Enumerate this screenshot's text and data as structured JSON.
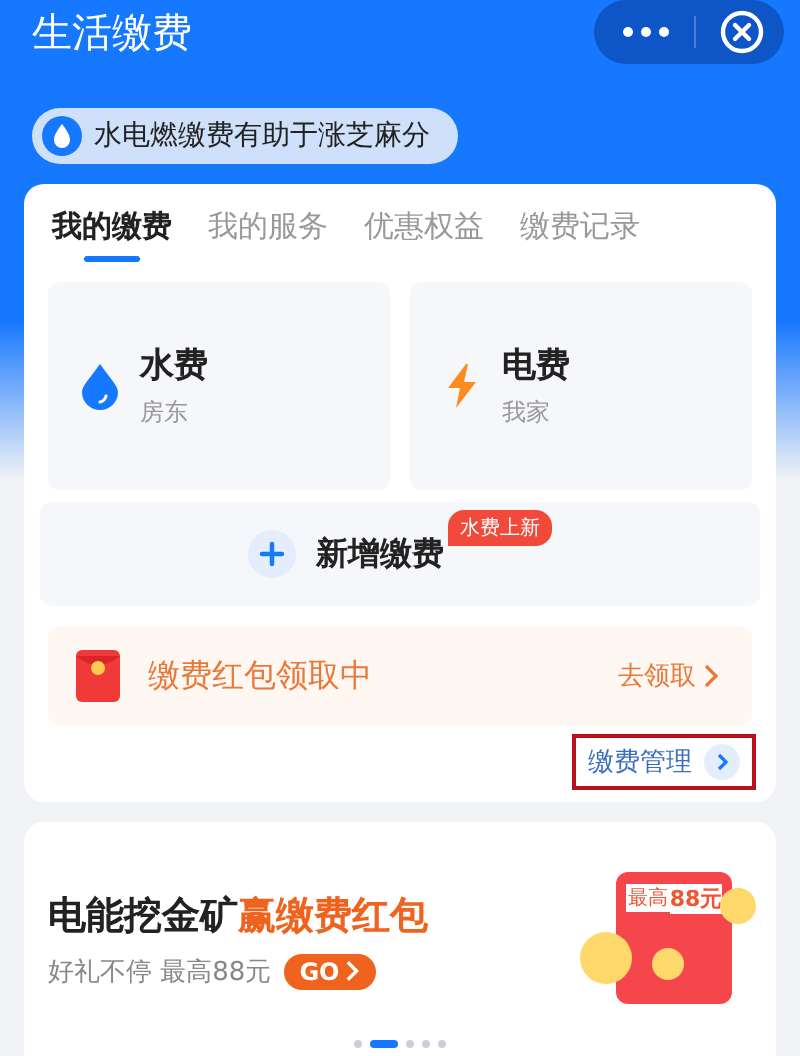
{
  "header": {
    "title": "生活缴费"
  },
  "promo_pill": {
    "text": "水电燃缴费有助于涨芝麻分"
  },
  "tabs": [
    {
      "label": "我的缴费",
      "selected": true
    },
    {
      "label": "我的服务",
      "selected": false
    },
    {
      "label": "优惠权益",
      "selected": false
    },
    {
      "label": "缴费记录",
      "selected": false
    }
  ],
  "bills": [
    {
      "kind": "water",
      "name": "水费",
      "account": "房东"
    },
    {
      "kind": "electric",
      "name": "电费",
      "account": "我家"
    }
  ],
  "add_bill": {
    "label": "新增缴费",
    "badge": "水费上新"
  },
  "red_packet": {
    "text": "缴费红包领取中",
    "action": "去领取"
  },
  "manage": {
    "label": "缴费管理",
    "highlighted": true
  },
  "banner": {
    "title": "电能挖金矿",
    "title_highlight": "赢缴费红包",
    "subtitle": "好礼不停 最高88元",
    "button": "GO",
    "prize_label": "最高",
    "prize_amount": "88元",
    "dots": [
      {
        "selected": false
      },
      {
        "selected": true
      },
      {
        "selected": false
      },
      {
        "selected": false
      },
      {
        "selected": false
      }
    ]
  }
}
